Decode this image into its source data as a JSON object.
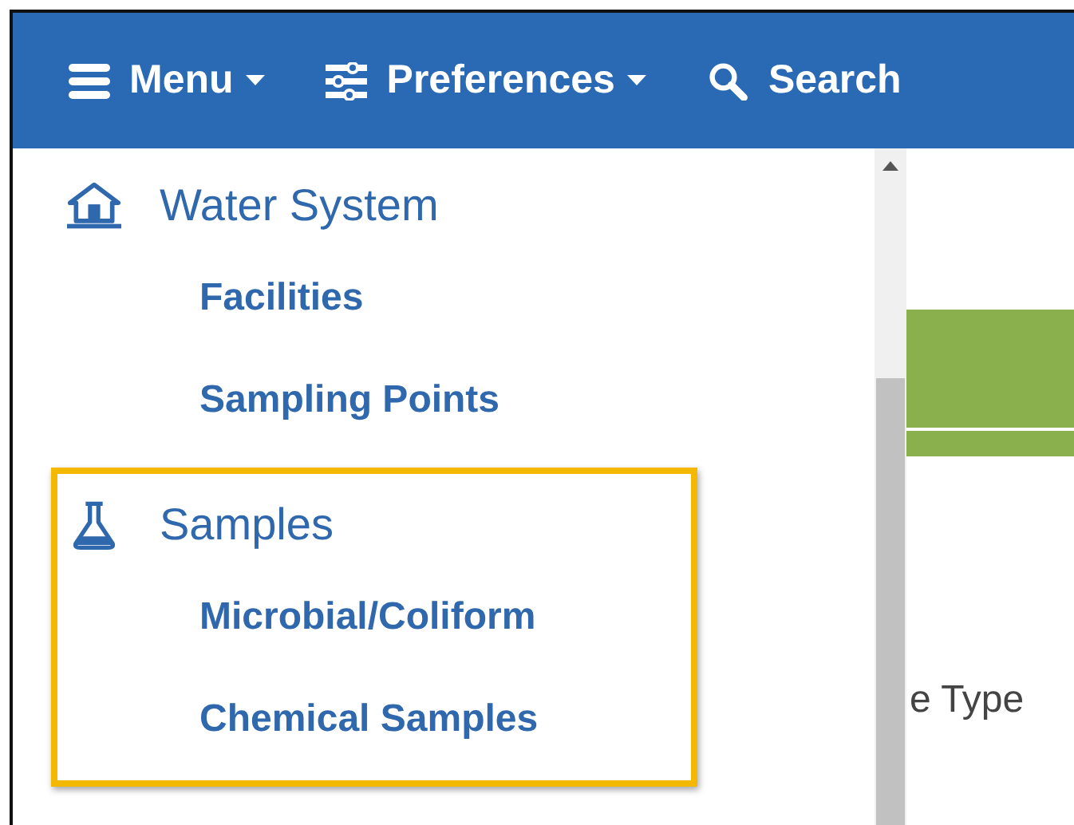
{
  "navbar": {
    "items": [
      {
        "kind": "menu",
        "label": "Menu"
      },
      {
        "kind": "preferences",
        "label": "Preferences"
      },
      {
        "kind": "search",
        "label": "Search"
      }
    ]
  },
  "menu": {
    "groups": [
      {
        "label": "Water System",
        "highlighted": false,
        "children": [
          {
            "label": "Facilities"
          },
          {
            "label": "Sampling Points"
          }
        ]
      },
      {
        "label": "Samples",
        "highlighted": true,
        "children": [
          {
            "label": "Microbial/Coliform"
          },
          {
            "label": "Chemical Samples"
          }
        ]
      }
    ]
  },
  "content": {
    "partial_label": "e Type"
  }
}
